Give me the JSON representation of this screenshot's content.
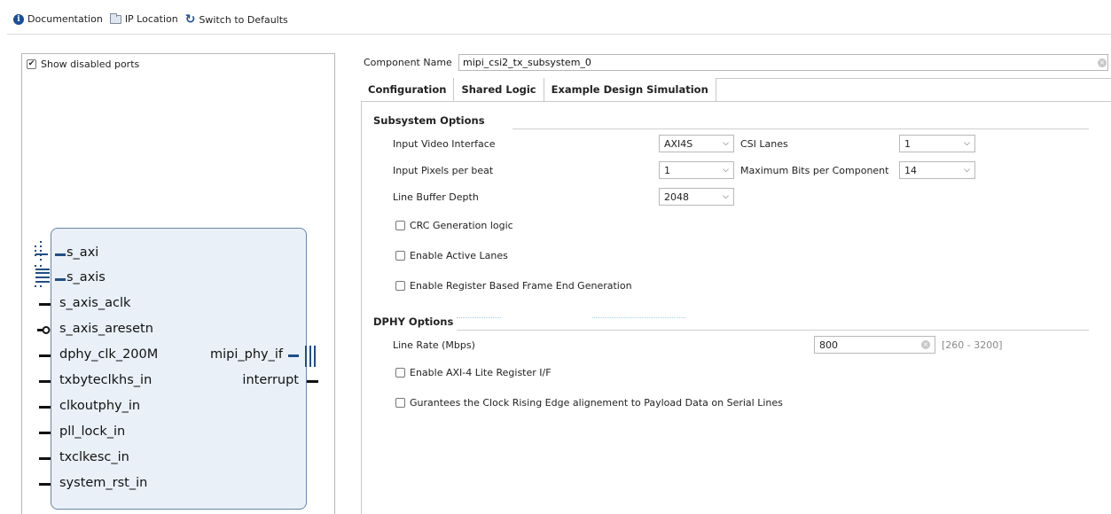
{
  "toolbar": {
    "documentation": "Documentation",
    "ip_location": "IP Location",
    "switch_defaults": "Switch to Defaults"
  },
  "left_panel": {
    "show_disabled_ports": "Show disabled ports",
    "show_disabled_ports_checked": true,
    "block": {
      "left_ports": [
        "s_axi",
        "s_axis",
        "s_axis_aclk",
        "s_axis_aresetn",
        "dphy_clk_200M",
        "txbyteclkhs_in",
        "clkoutphy_in",
        "pll_lock_in",
        "txclkesc_in",
        "system_rst_in"
      ],
      "right_ports": [
        "mipi_phy_if",
        "interrupt"
      ]
    }
  },
  "component": {
    "label": "Component Name",
    "value": "mipi_csi2_tx_subsystem_0"
  },
  "tabs": [
    "Configuration",
    "Shared Logic",
    "Example Design Simulation"
  ],
  "subsystem": {
    "title": "Subsystem Options",
    "input_video_interface": {
      "label": "Input Video Interface",
      "value": "AXI4S"
    },
    "csi_lanes": {
      "label": "CSI Lanes",
      "value": "1"
    },
    "input_pixels_per_beat": {
      "label": "Input Pixels per beat",
      "value": "1"
    },
    "max_bits_per_component": {
      "label": "Maximum Bits per Component",
      "value": "14"
    },
    "line_buffer_depth": {
      "label": "Line Buffer Depth",
      "value": "2048"
    },
    "crc_generation": {
      "label": "CRC Generation logic",
      "checked": false
    },
    "enable_active_lanes": {
      "label": "Enable Active Lanes",
      "checked": false
    },
    "register_frame_end": {
      "label": "Enable Register Based Frame End Generation",
      "checked": false
    }
  },
  "dphy": {
    "title": "DPHY Options",
    "line_rate": {
      "label": "Line Rate (Mbps)",
      "value": "800",
      "range": "[260 - 3200]"
    },
    "axi_lite": {
      "label": "Enable AXI-4 Lite Register I/F",
      "checked": false
    },
    "clock_rising": {
      "label": "Gurantees the Clock Rising Edge alignement to Payload Data on Serial Lines",
      "checked": false
    }
  }
}
